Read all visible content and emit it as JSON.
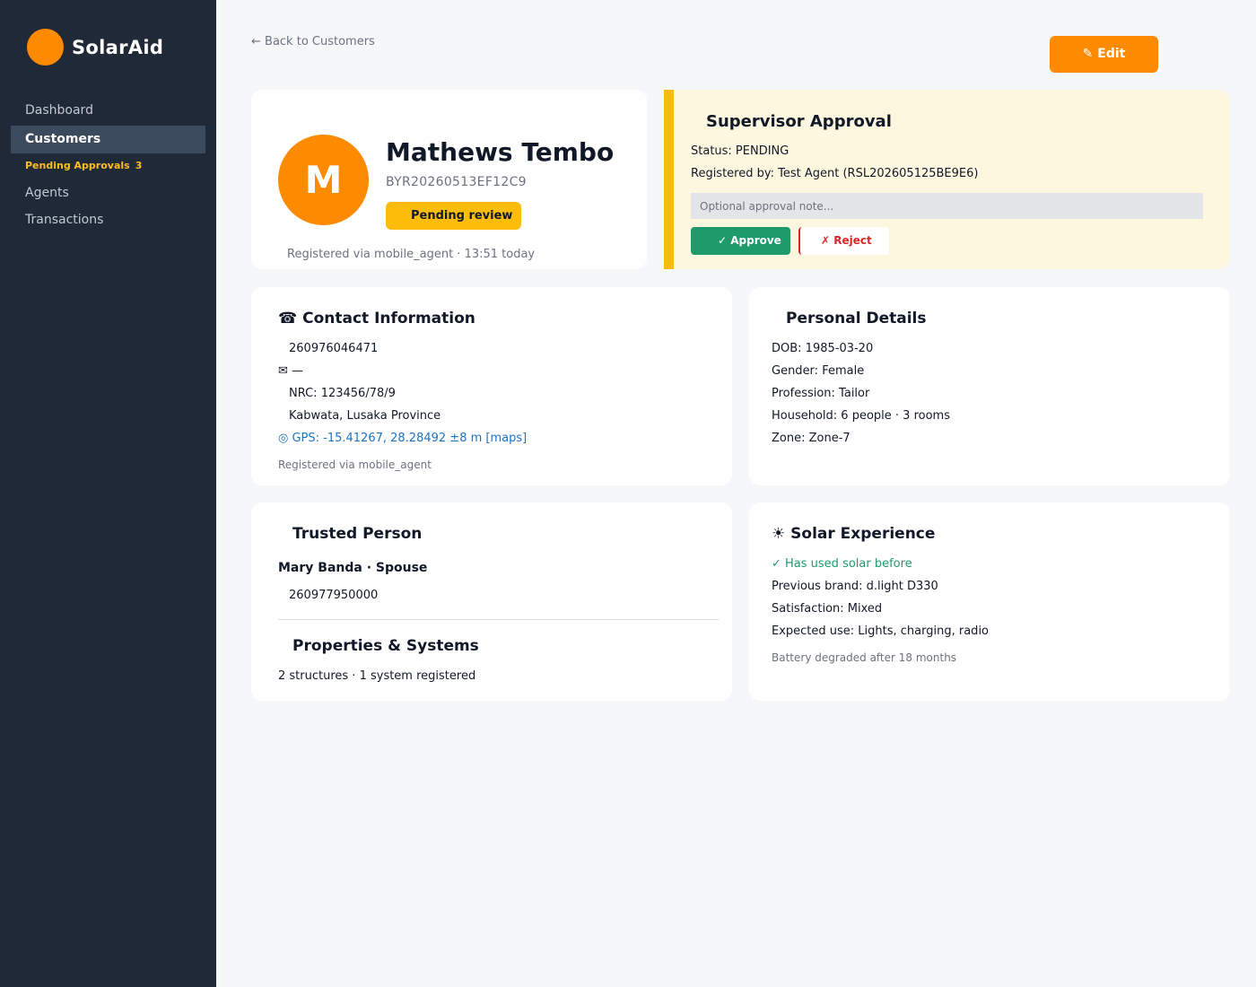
{
  "app": {
    "name": "SolarAid"
  },
  "sidebar": {
    "items": [
      {
        "label": "Dashboard"
      },
      {
        "label": "Customers"
      },
      {
        "label": "Agents"
      },
      {
        "label": "Transactions"
      }
    ],
    "pending": {
      "label": "Pending Approvals",
      "count": "3"
    }
  },
  "header": {
    "back_label": "← Back to Customers",
    "edit_label": "✎ Edit"
  },
  "profile": {
    "initial": "M",
    "name": "Mathews Tembo",
    "id": "BYR20260513EF12C9",
    "status": "Pending review",
    "registered_note": "Registered via mobile_agent · 13:51 today"
  },
  "approval": {
    "title": "Supervisor Approval",
    "status": "Status: PENDING",
    "registered_by": "Registered by: Test Agent (RSL202605125BE9E6)",
    "note_placeholder": "Optional approval note...",
    "approve_label": "✓ Approve",
    "reject_label": "✗ Reject"
  },
  "contact": {
    "title": "☎ Contact Information",
    "phone": "260976046471",
    "email": "✉ —",
    "nrc": "NRC: 123456/78/9",
    "location": "Kabwata, Lusaka Province",
    "gps": "◎ GPS: -15.41267, 28.28492 ±8 m  [maps]",
    "registered": "Registered via mobile_agent"
  },
  "personal": {
    "title": "Personal Details",
    "dob": "DOB: 1985-03-20",
    "gender": "Gender: Female",
    "profession": "Profession: Tailor",
    "household": "Household: 6 people · 3 rooms",
    "zone": "Zone: Zone-7"
  },
  "trusted": {
    "title": "Trusted Person",
    "name": "Mary Banda · Spouse",
    "phone": "260977950000"
  },
  "properties": {
    "title": "Properties & Systems",
    "summary": "2 structures · 1 system registered"
  },
  "solar": {
    "title": "☀ Solar Experience",
    "used": "✓ Has used solar before",
    "brand": "Previous brand: d.light D330",
    "satisfaction": "Satisfaction: Mixed",
    "expected": "Expected use: Lights, charging, radio",
    "note": "Battery degraded after 18 months"
  },
  "colors": {
    "sidebar_bg": "#1f2937",
    "brand_orange": "#fe8a00",
    "pending_yellow": "#fbbd0a",
    "approve_green": "#1f9a6a",
    "reject_red": "#dc2626",
    "link_blue": "#1d74c4"
  }
}
